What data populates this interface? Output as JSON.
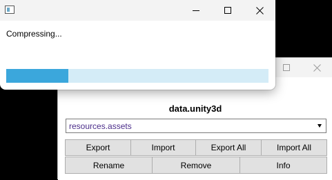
{
  "progress_dialog": {
    "status": "Compressing...",
    "progress_fraction": 0.236,
    "title_icons": [
      "app-icon",
      "minimize-icon",
      "maximize-icon",
      "close-icon"
    ]
  },
  "bundle_window": {
    "title": "data.unity3d",
    "selected_file": "resources.assets",
    "buttons_row1": [
      "Export",
      "Import",
      "Export All",
      "Import All"
    ],
    "buttons_row2": [
      "Rename",
      "Remove",
      "Info"
    ],
    "title_icons": [
      "maximize-icon",
      "close-icon"
    ]
  },
  "colors": {
    "progress_fill": "#3ba7dc",
    "progress_track": "#d4ecf7",
    "dropdown_text": "#4b2d8a"
  }
}
